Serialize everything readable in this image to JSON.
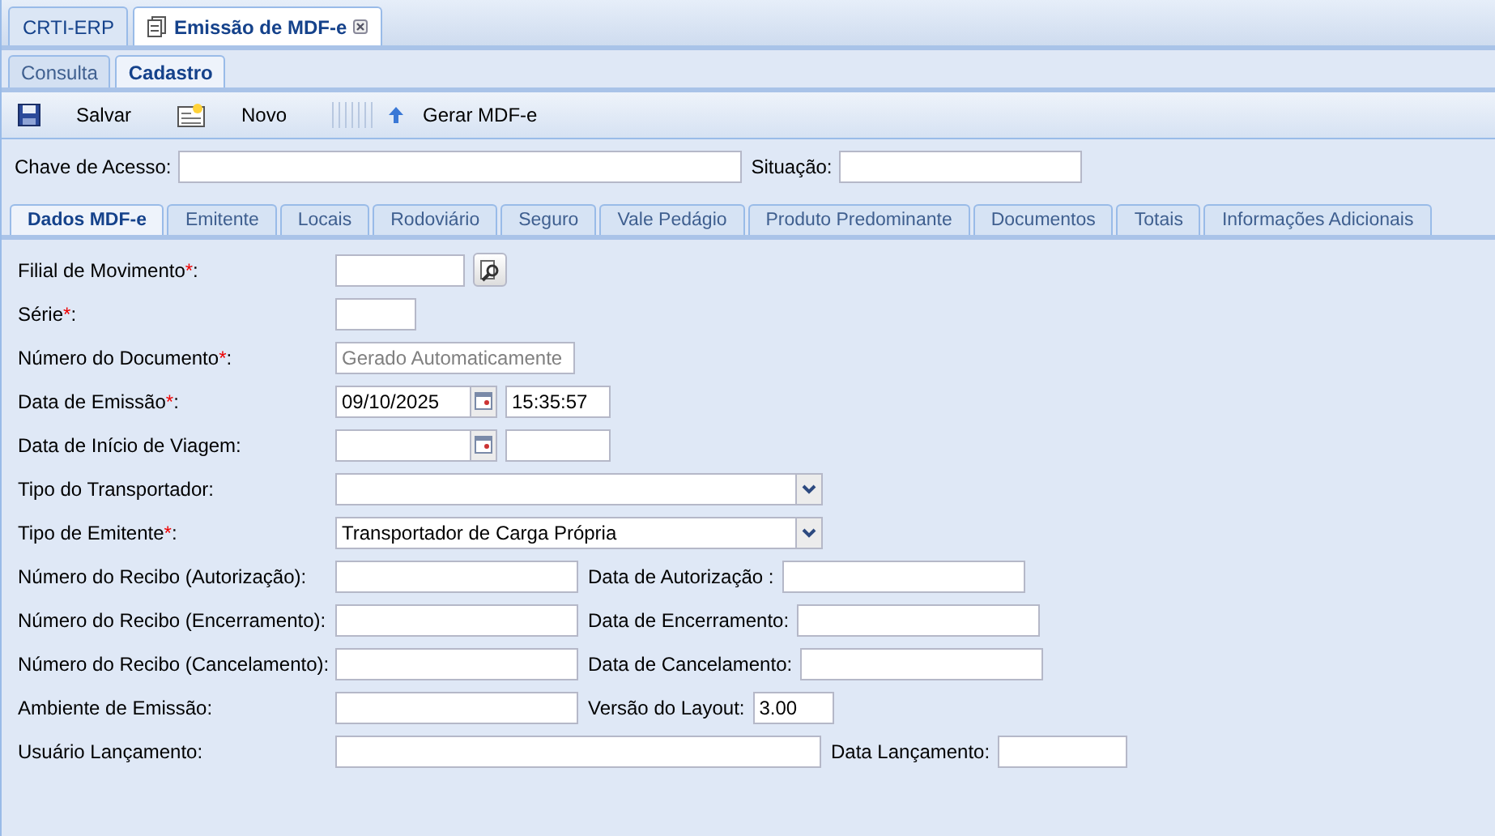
{
  "app_tabs": [
    {
      "label": "CRTI-ERP",
      "selected": false,
      "closable": false
    },
    {
      "label": "Emissão de MDF-e",
      "selected": true,
      "closable": true
    }
  ],
  "sub_tabs": [
    {
      "label": "Consulta",
      "selected": false
    },
    {
      "label": "Cadastro",
      "selected": true
    }
  ],
  "toolbar": [
    {
      "kind": "save",
      "label": "Salvar"
    },
    {
      "kind": "new",
      "label": "Novo"
    },
    {
      "kind": "generate",
      "label": "Gerar MDF-e"
    }
  ],
  "key_row": [
    {
      "label": "Chave de Acesso:"
    },
    {
      "label": "Situação:"
    }
  ],
  "form_tabs": [
    {
      "label": "Dados MDF-e",
      "selected": true
    },
    {
      "label": "Emitente",
      "selected": false
    },
    {
      "label": "Locais",
      "selected": false
    },
    {
      "label": "Rodoviário",
      "selected": false
    },
    {
      "label": "Seguro",
      "selected": false
    },
    {
      "label": "Vale Pedágio",
      "selected": false
    },
    {
      "label": "Produto Predominante",
      "selected": false
    },
    {
      "label": "Documentos",
      "selected": false
    },
    {
      "label": "Totais",
      "selected": false
    },
    {
      "label": "Informações Adicionais",
      "selected": false
    }
  ],
  "rows": [
    {
      "label": "Filial de Movimento",
      "required_mark": "*",
      "label_end": ":",
      "fields": [
        {
          "kind": "lookup"
        }
      ]
    },
    {
      "label": "Série",
      "required_mark": "*",
      "label_end": ":",
      "fields": [
        {
          "kind": "text"
        }
      ]
    },
    {
      "label": "Número do Documento",
      "required_mark": "*",
      "label_end": ":",
      "fields": [
        {
          "kind": "text",
          "placeholder": "Gerado Automaticamente"
        }
      ]
    },
    {
      "label": "Data de Emissão",
      "required_mark": "*",
      "label_end": ":",
      "fields": [
        {
          "kind": "date",
          "value": "09/10/2025"
        },
        {
          "kind": "text",
          "value": "15:35:57"
        }
      ]
    },
    {
      "label": "Data de Início de Viagem:",
      "fields": [
        {
          "kind": "date"
        },
        {
          "kind": "text"
        }
      ]
    },
    {
      "label": "Tipo do Transportador:",
      "fields": [
        {
          "kind": "select"
        }
      ]
    },
    {
      "label": "Tipo de Emitente",
      "required_mark": "*",
      "label_end": ":",
      "fields": [
        {
          "kind": "select",
          "value": "Transportador de Carga Própria"
        }
      ]
    },
    {
      "label": "Número do Recibo (Autorização):",
      "fields": [
        {
          "kind": "text"
        },
        {
          "kind": "text",
          "label": "Data de Autorização :"
        }
      ]
    },
    {
      "label": "Número do Recibo (Encerramento):",
      "fields": [
        {
          "kind": "text"
        },
        {
          "kind": "text",
          "label": "Data de Encerramento:"
        }
      ]
    },
    {
      "label": "Número do Recibo (Cancelamento):",
      "fields": [
        {
          "kind": "text"
        },
        {
          "kind": "text",
          "label": "Data de Cancelamento:"
        }
      ]
    },
    {
      "label": "Ambiente de Emissão:",
      "fields": [
        {
          "kind": "text"
        },
        {
          "kind": "text",
          "label": "Versão do Layout:",
          "value": "3.00"
        }
      ]
    },
    {
      "label": "Usuário Lançamento:",
      "fields": [
        {
          "kind": "text"
        },
        {
          "kind": "text",
          "label": "Data Lançamento:"
        }
      ]
    }
  ]
}
